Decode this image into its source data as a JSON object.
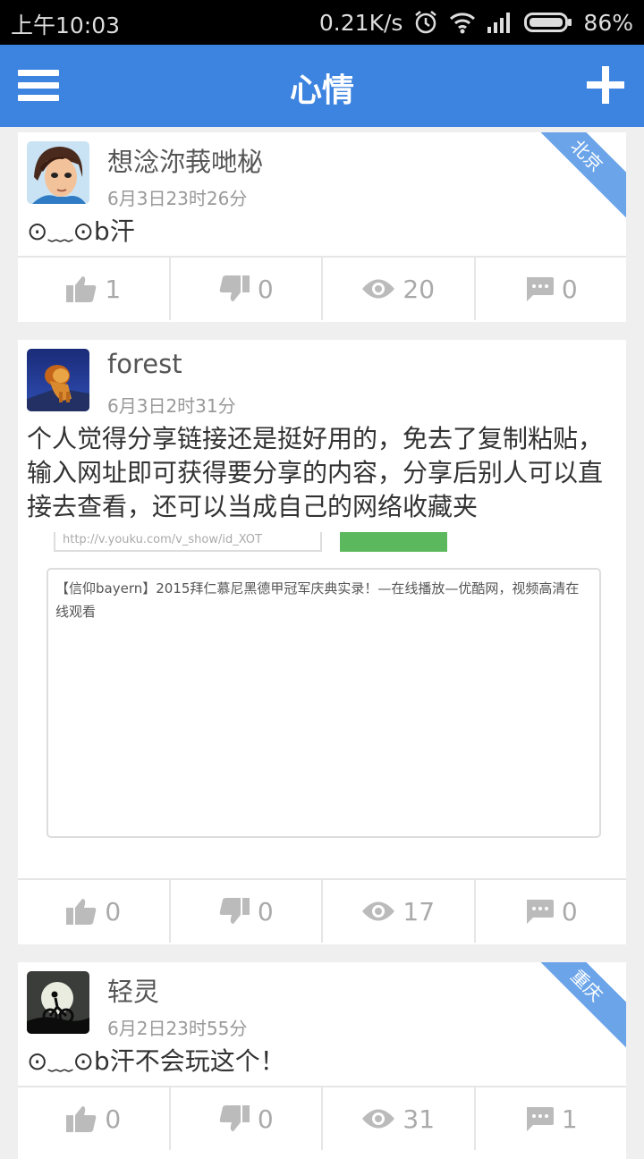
{
  "status_bar": {
    "time": "上午10:03",
    "net_speed": "0.21K/s",
    "battery": "86%",
    "icons": [
      "alarm-icon",
      "wifi-icon",
      "signal-icon",
      "battery-icon"
    ]
  },
  "app_bar": {
    "title": "心情",
    "left_icon": "menu-icon",
    "right_icon": "add-icon",
    "color": "#3d84e0"
  },
  "posts": [
    {
      "username": "想淰沵莪哋柲",
      "time": "6月3日23时26分",
      "content": "⊙﹏⊙b汗",
      "location": "北京",
      "likes": "1",
      "dislikes": "0",
      "views": "20",
      "comments": "0"
    },
    {
      "username": "forest",
      "time": "6月3日2时31分",
      "content": "个人觉得分享链接还是挺好用的，免去了复制粘贴，输入网址即可获得要分享的内容，分享后别人可以直接去查看，还可以当成自己的网络收藏夹",
      "image": {
        "url_text": "http://v.youku.com/v_show/id_XOT",
        "box_text": "【信仰bayern】2015拜仁慕尼黑德甲冠军庆典实录！—在线播放—优酷网，视频高清在线观看"
      },
      "likes": "0",
      "dislikes": "0",
      "views": "17",
      "comments": "0"
    },
    {
      "username": "轻灵",
      "time": "6月2日23时55分",
      "content": "⊙﹏⊙b汗不会玩这个！",
      "location": "重庆",
      "likes": "0",
      "dislikes": "0",
      "views": "31",
      "comments": "1"
    }
  ]
}
